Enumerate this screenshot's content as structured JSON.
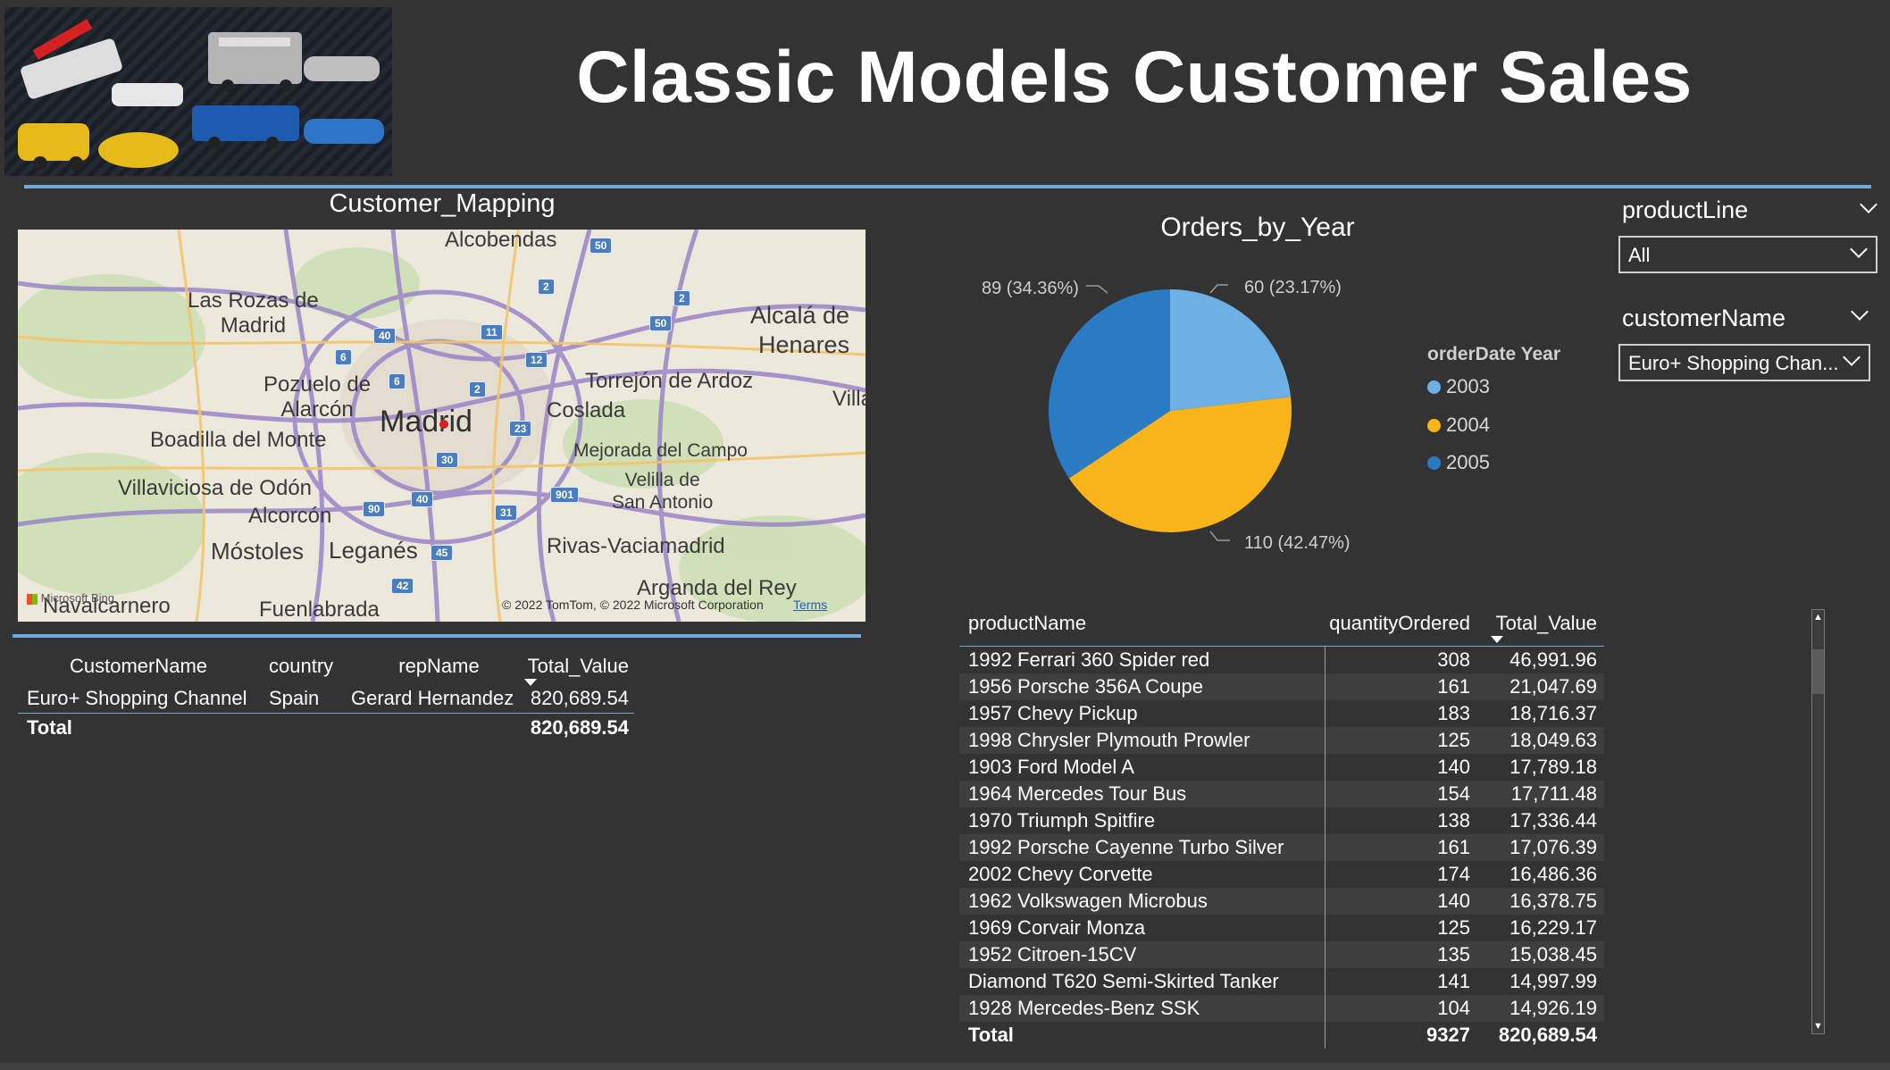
{
  "header": {
    "title": "Classic Models Customer Sales",
    "logo_icon": "toy-cars-banner-image"
  },
  "map_visual": {
    "title": "Customer_Mapping",
    "places": {
      "alcobendas": "Alcobendas",
      "las_rozas": "Las Rozas de\nMadrid",
      "alcala": "Alcalá de\nHenares",
      "pozuelo": "Pozuelo de\nAlarcón",
      "madrid": "Madrid",
      "torrejon": "Torrejón de Ardoz",
      "coslada": "Coslada",
      "villa": "Villa",
      "boadilla": "Boadilla del Monte",
      "mejorada": "Mejorada del Campo",
      "villaviciosa": "Villaviciosa de Odón",
      "velilla": "Velilla de\nSan Antonio",
      "alcorcon": "Alcorcón",
      "mostoles": "Móstoles",
      "leganes": "Leganés",
      "rivas": "Rivas-Vaciamadrid",
      "navalcarnero": "Navalcarnero",
      "fuenlabrada": "Fuenlabrada",
      "arganda": "Arganda del Rey"
    },
    "roads": [
      "50",
      "2",
      "2",
      "40",
      "11",
      "50",
      "6",
      "12",
      "6",
      "2",
      "23",
      "30",
      "40",
      "90",
      "901",
      "31",
      "45",
      "42"
    ],
    "bing_label": "Microsoft Bing",
    "copyright": "© 2022 TomTom, © 2022 Microsoft Corporation",
    "terms": "Terms"
  },
  "customer_table": {
    "headers": [
      "CustomerName",
      "country",
      "repName",
      "Total_Value"
    ],
    "rows": [
      [
        "Euro+ Shopping Channel",
        "Spain",
        "Gerard Hernandez",
        "820,689.54"
      ]
    ],
    "total_label": "Total",
    "total_value": "820,689.54"
  },
  "pie": {
    "title": "Orders_by_Year",
    "label_2003": "60 (23.17%)",
    "label_2004": "110 (42.47%)",
    "label_2005": "89 (34.36%)",
    "legend_title": "orderDate Year",
    "legend": [
      "2003",
      "2004",
      "2005"
    ]
  },
  "chart_data": {
    "type": "pie",
    "title": "Orders_by_Year",
    "legend_title": "orderDate Year",
    "categories": [
      "2003",
      "2004",
      "2005"
    ],
    "values": [
      60,
      110,
      89
    ],
    "percentages": [
      23.17,
      42.47,
      34.36
    ],
    "colors": [
      "#6cb0e6",
      "#f8b418",
      "#2a7bc4"
    ],
    "legend_position": "right"
  },
  "slicers": {
    "product_line": {
      "label": "productLine",
      "value": "All"
    },
    "customer_name": {
      "label": "customerName",
      "value": "Euro+ Shopping Chan..."
    }
  },
  "product_table": {
    "headers": [
      "productName",
      "quantityOrdered",
      "Total_Value"
    ],
    "rows": [
      [
        "1992 Ferrari 360 Spider red",
        "308",
        "46,991.96"
      ],
      [
        "1956 Porsche 356A Coupe",
        "161",
        "21,047.69"
      ],
      [
        "1957 Chevy Pickup",
        "183",
        "18,716.37"
      ],
      [
        "1998 Chrysler Plymouth Prowler",
        "125",
        "18,049.63"
      ],
      [
        "1903 Ford Model A",
        "140",
        "17,789.18"
      ],
      [
        "1964 Mercedes Tour Bus",
        "154",
        "17,711.48"
      ],
      [
        "1970 Triumph Spitfire",
        "138",
        "17,336.44"
      ],
      [
        "1992 Porsche Cayenne Turbo Silver",
        "161",
        "17,076.39"
      ],
      [
        "2002 Chevy Corvette",
        "174",
        "16,486.36"
      ],
      [
        "1962 Volkswagen Microbus",
        "140",
        "16,378.75"
      ],
      [
        "1969 Corvair Monza",
        "125",
        "16,229.17"
      ],
      [
        "1952 Citroen-15CV",
        "135",
        "15,038.45"
      ],
      [
        "Diamond T620 Semi-Skirted Tanker",
        "141",
        "14,997.99"
      ],
      [
        "1928 Mercedes-Benz SSK",
        "104",
        "14,926.19"
      ]
    ],
    "total_label": "Total",
    "total_quantity": "9327",
    "total_value": "820,689.54"
  },
  "colors": {
    "background": "#333333",
    "accent_line": "#6fa8dc",
    "pie_2003": "#6cb0e6",
    "pie_2004": "#f8b418",
    "pie_2005": "#2a7bc4"
  }
}
